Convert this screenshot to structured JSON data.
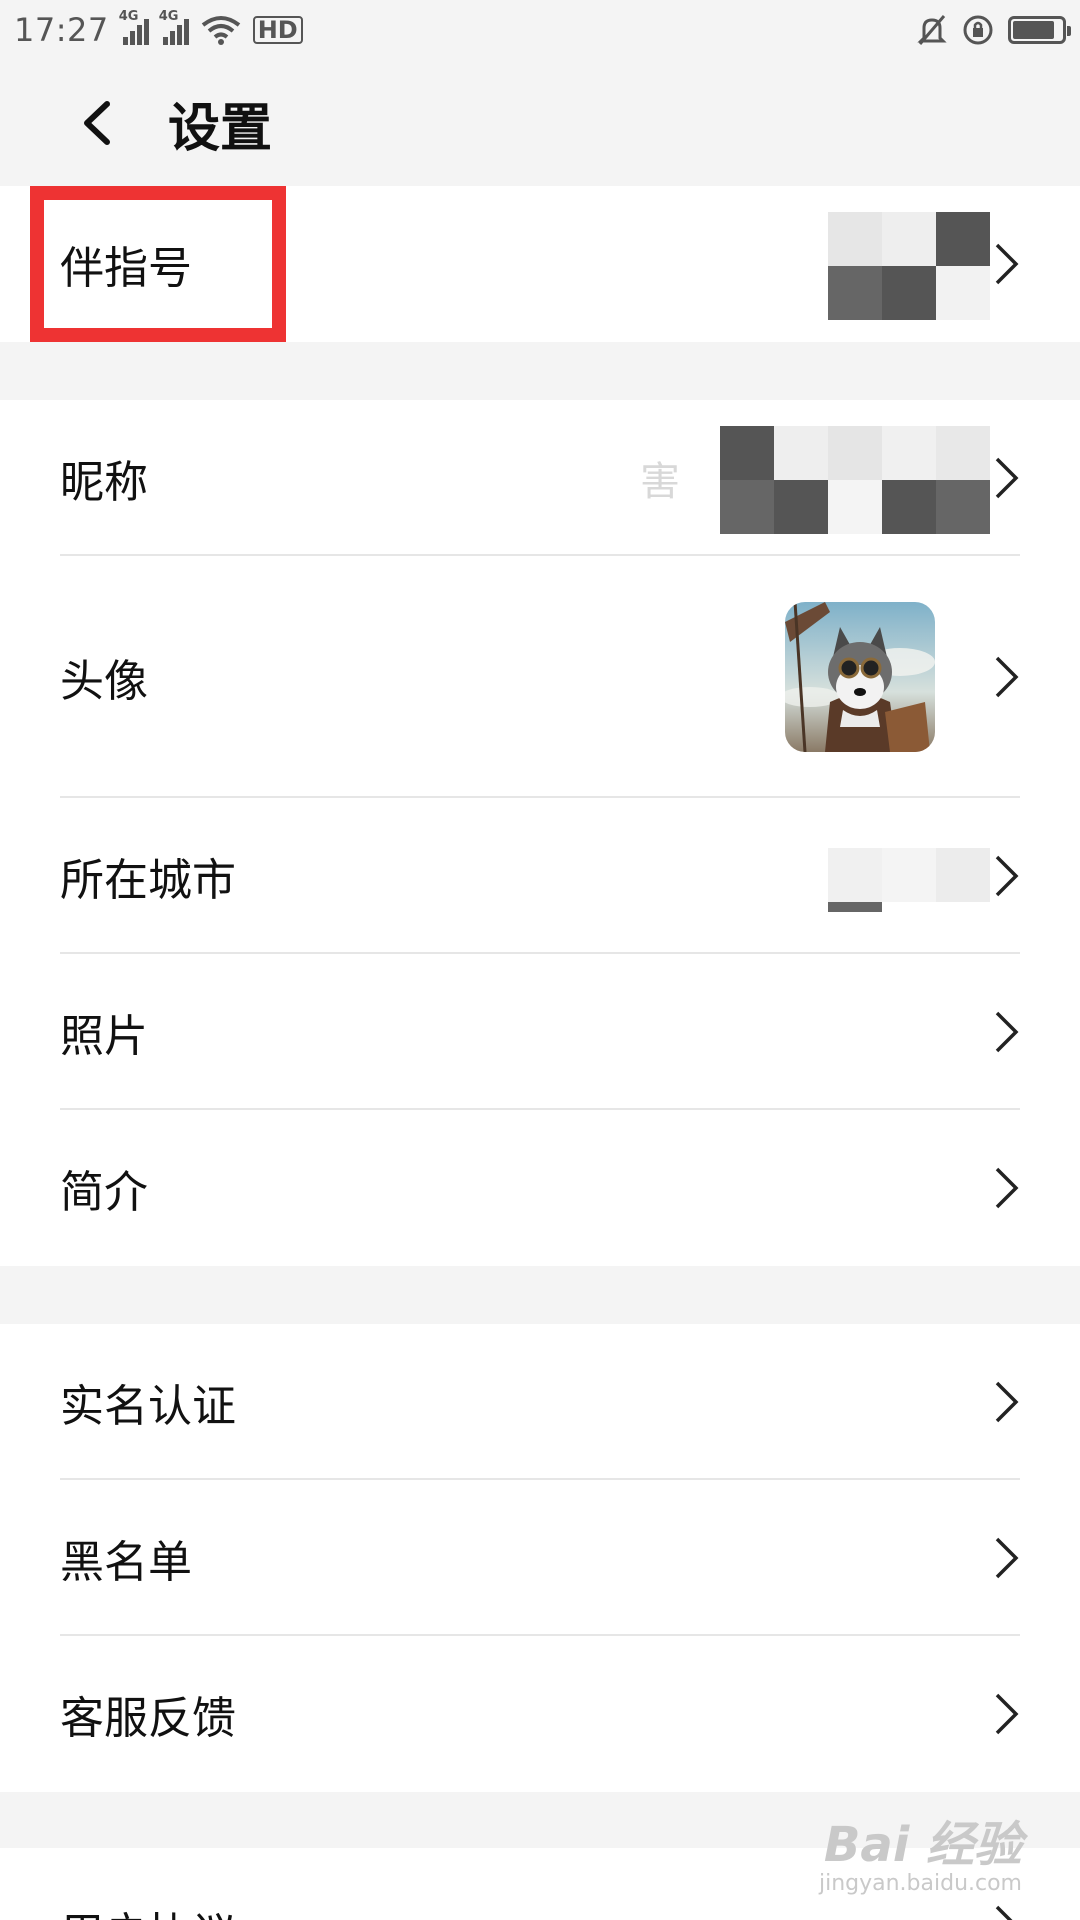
{
  "status_bar": {
    "time": "17:27",
    "network_1": "4G",
    "network_2": "4G",
    "hd_label": "HD",
    "battery_level": 0.85
  },
  "header": {
    "title": "设置",
    "back_icon": "chevron-left-icon"
  },
  "groups": [
    {
      "rows": [
        {
          "label": "伴指号",
          "value": "114",
          "value_masked": true,
          "chevron_icon": "chevron-right-icon"
        }
      ]
    },
    {
      "rows": [
        {
          "label": "昵称",
          "value": "害",
          "value_masked": true,
          "chevron_icon": "chevron-right-icon"
        },
        {
          "label": "头像",
          "avatar": "husky-pilot-avatar",
          "chevron_icon": "chevron-right-icon"
        },
        {
          "label": "所在城市",
          "value": "",
          "value_masked": true,
          "chevron_icon": "chevron-right-icon"
        },
        {
          "label": "照片",
          "chevron_icon": "chevron-right-icon"
        },
        {
          "label": "简介",
          "chevron_icon": "chevron-right-icon"
        }
      ]
    },
    {
      "rows": [
        {
          "label": "实名认证",
          "chevron_icon": "chevron-right-icon"
        },
        {
          "label": "黑名单",
          "chevron_icon": "chevron-right-icon"
        },
        {
          "label": "客服反馈",
          "chevron_icon": "chevron-right-icon"
        }
      ]
    },
    {
      "rows": [
        {
          "label": "用户协议",
          "chevron_icon": "chevron-right-icon"
        }
      ]
    }
  ],
  "highlight_color": "#ee3333",
  "watermark": {
    "brand": "Bai 经验",
    "url": "jingyan.baidu.com"
  }
}
